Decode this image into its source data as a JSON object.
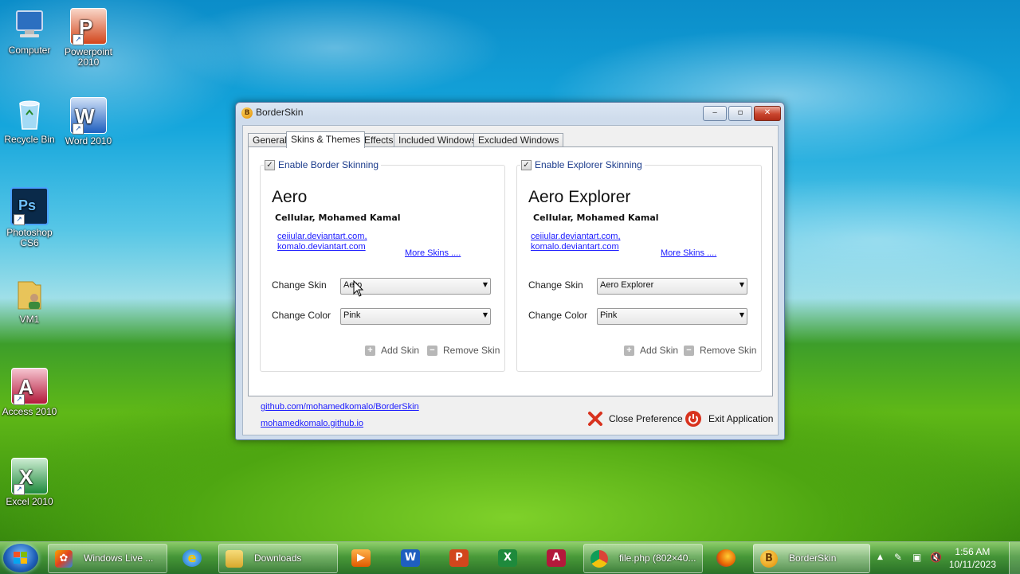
{
  "desktop": {
    "icons": [
      {
        "label": "Computer",
        "icon": "computer-icon"
      },
      {
        "label": "Powerpoint 2010",
        "icon": "powerpoint-icon"
      },
      {
        "label": "Recycle Bin",
        "icon": "recycle-bin-icon"
      },
      {
        "label": "Word 2010",
        "icon": "word-icon"
      },
      {
        "label": "Photoshop CS6",
        "icon": "photoshop-icon"
      },
      {
        "label": "VM1",
        "icon": "folder-user-icon"
      },
      {
        "label": "Access 2010",
        "icon": "access-icon"
      },
      {
        "label": "Excel 2010",
        "icon": "excel-icon"
      }
    ]
  },
  "window": {
    "title": "BorderSkin",
    "app_icon_glyph": "B",
    "minimize": "‒",
    "maximize": "▫",
    "close": "✕",
    "tabs": [
      {
        "label": "General"
      },
      {
        "label": "Skins & Themes",
        "active": true
      },
      {
        "label": "Effects"
      },
      {
        "label": "Included Windows"
      },
      {
        "label": "Excluded Windows"
      }
    ],
    "border_group": {
      "checkbox_label": "Enable Border Skinning",
      "checked": true,
      "skin_name": "Aero",
      "author": "CeIIular, Mohamed Kamal",
      "link_1": "ceiiular.deviantart.com,",
      "link_2": "komalo.deviantart.com",
      "more_skins": "More Skins ....",
      "change_skin_label": "Change Skin",
      "change_skin_value": "Aero",
      "change_color_label": "Change Color",
      "change_color_value": "Pink",
      "add_skin": "Add Skin",
      "remove_skin": "Remove Skin"
    },
    "explorer_group": {
      "checkbox_label": "Enable Explorer Skinning",
      "checked": true,
      "skin_name": "Aero Explorer",
      "author": "CeIIular, Mohamed Kamal",
      "link_1": "ceiiular.deviantart.com,",
      "link_2": "komalo.deviantart.com",
      "more_skins": "More Skins ....",
      "change_skin_label": "Change Skin",
      "change_skin_value": "Aero Explorer",
      "change_color_label": "Change Color",
      "change_color_value": "Pink",
      "add_skin": "Add Skin",
      "remove_skin": "Remove Skin"
    },
    "footer": {
      "link_github": "github.com/mohamedkomalo/BorderSkin",
      "link_site": "mohamedkomalo.github.io",
      "close_preference": "Close Preference",
      "exit_application": "Exit Application"
    }
  },
  "taskbar": {
    "windows_live": "Windows Live ...",
    "downloads": "Downloads",
    "chrome": "file.php (802×40...",
    "borderskin": "BorderSkin",
    "pinned_icons": [
      "media-player-icon",
      "word-icon",
      "powerpoint-icon",
      "excel-icon",
      "access-icon"
    ],
    "clock_time": "1:56 AM",
    "clock_date": "10/11/2023"
  },
  "colors": {
    "link": "#1a1aff",
    "group_label": "#1c3c8c",
    "close_red": "#c9452e"
  }
}
